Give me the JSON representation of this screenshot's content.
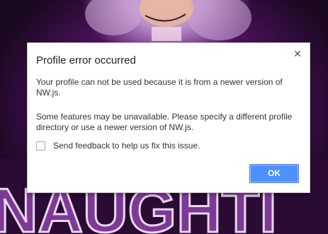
{
  "dialog": {
    "title": "Profile error occurred",
    "close_icon": "close-icon",
    "message_primary": "Your profile can not be used because it is from a newer version of NW.js.",
    "message_secondary": "Some features may be unavailable. Please specify a different profile directory or use a newer version of NW.js.",
    "feedback_label": "Send feedback to help us fix this issue.",
    "feedback_checked": false,
    "ok_label": "OK"
  },
  "background": {
    "banner_text": "NAUGHTI"
  },
  "colors": {
    "accent": "#4d90fe",
    "background_purple": "#6a1a82"
  }
}
